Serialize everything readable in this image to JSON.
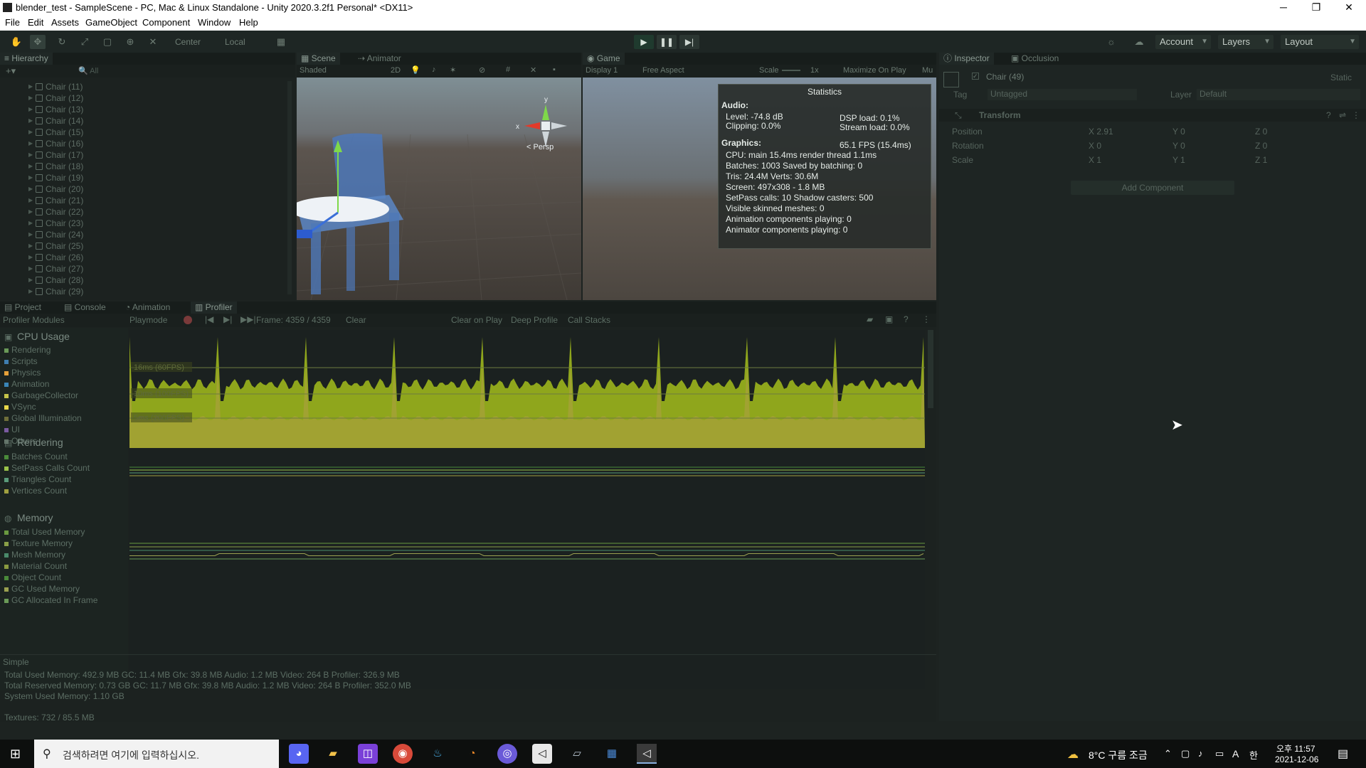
{
  "window": {
    "title": "blender_test - SampleScene - PC, Mac & Linux Standalone - Unity 2020.3.2f1 Personal* <DX11>",
    "minimize_icon": "─",
    "restore_icon": "❐",
    "close_icon": "✕"
  },
  "menu": [
    "File",
    "Edit",
    "Assets",
    "GameObject",
    "Component",
    "Window",
    "Help"
  ],
  "toolbar": {
    "center_label": "Center",
    "local_label": "Local",
    "account_label": "Account",
    "layers_label": "Layers",
    "layout_label": "Layout"
  },
  "hierarchy": {
    "tab": "Hierarchy",
    "search_placeholder": "All",
    "items": [
      "Chair (11)",
      "Chair (12)",
      "Chair (13)",
      "Chair (14)",
      "Chair (15)",
      "Chair (16)",
      "Chair (17)",
      "Chair (18)",
      "Chair (19)",
      "Chair (20)",
      "Chair (21)",
      "Chair (22)",
      "Chair (23)",
      "Chair (24)",
      "Chair (25)",
      "Chair (26)",
      "Chair (27)",
      "Chair (28)",
      "Chair (29)"
    ]
  },
  "scene": {
    "tabs": [
      "Scene",
      "Animator"
    ],
    "shading": "Shaded",
    "mode_2d": "2D",
    "persp_label": "< Persp",
    "gizmo_y": "y",
    "gizmo_x": "x"
  },
  "game": {
    "tab": "Game",
    "display": "Display 1",
    "aspect": "Free Aspect",
    "scale_label": "Scale",
    "scale_value": "1x",
    "maximize": "Maximize On Play",
    "mute": "Mu"
  },
  "statistics": {
    "title": "Statistics",
    "audio_head": "Audio:",
    "level": "Level: -74.8 dB",
    "dsp": "DSP load: 0.1%",
    "clipping": "Clipping: 0.0%",
    "stream": "Stream load: 0.0%",
    "graphics_head": "Graphics:",
    "fps": "65.1 FPS (15.4ms)",
    "cpu": "CPU: main 15.4ms  render thread 1.1ms",
    "batches": "Batches: 1003   Saved by batching: 0",
    "tris": "Tris: 24.4M       Verts: 30.6M",
    "screen": "Screen: 497x308 - 1.8 MB",
    "setpass": "SetPass calls: 10        Shadow casters: 500",
    "skinned": "Visible skinned meshes: 0",
    "anim": "Animation components playing: 0",
    "animator": "Animator components playing: 0"
  },
  "inspector": {
    "tabs": [
      "Inspector",
      "Occlusion"
    ],
    "object_name": "Chair (49)",
    "static_label": "Static",
    "tag_label": "Tag",
    "tag_value": "Untagged",
    "layer_label": "Layer",
    "layer_value": "Default",
    "transform_label": "Transform",
    "position_label": "Position",
    "rotation_label": "Rotation",
    "scale_label": "Scale",
    "position": {
      "x": "X 2.91",
      "y": "Y 0",
      "z": "Z 0"
    },
    "rotation": {
      "x": "X 0",
      "y": "Y 0",
      "z": "Z 0"
    },
    "scale": {
      "x": "X 1",
      "y": "Y 1",
      "z": "Z 1"
    },
    "add_component": "Add Component"
  },
  "bottom_tabs": [
    "Project",
    "Console",
    "Animation",
    "Profiler"
  ],
  "profiler": {
    "modules_label": "Profiler Modules",
    "playmode": "Playmode",
    "frame": "Frame: 4359 / 4359",
    "clear": "Clear",
    "clear_on_play": "Clear on Play",
    "deep_profile": "Deep Profile",
    "call_stacks": "Call Stacks",
    "cpu": {
      "title": "CPU Usage",
      "items": [
        "Rendering",
        "Scripts",
        "Physics",
        "Animation",
        "GarbageCollector",
        "VSync",
        "Global Illumination",
        "UI",
        "Others"
      ],
      "colors": [
        "#6a9a58",
        "#3f7eb0",
        "#e6a13a",
        "#3a86b8",
        "#c4c34a",
        "#e8d84a",
        "#6e6e3a",
        "#7a5aa0",
        "#6a7a70"
      ],
      "threshold_16": "16ms (60FPS)",
      "threshold_10": "10ms (100FPS)",
      "threshold_5": "5ms (200FPS)"
    },
    "rendering": {
      "title": "Rendering",
      "items": [
        "Batches Count",
        "SetPass Calls Count",
        "Triangles Count",
        "Vertices Count"
      ],
      "colors": [
        "#4a8a3a",
        "#9ac24a",
        "#5a9a7a",
        "#a0a040"
      ]
    },
    "memory": {
      "title": "Memory",
      "items": [
        "Total Used Memory",
        "Texture Memory",
        "Mesh Memory",
        "Material Count",
        "Object Count",
        "GC Used Memory",
        "GC Allocated In Frame"
      ],
      "colors": [
        "#6a9a40",
        "#8aa048",
        "#4a8a6a",
        "#8a9a40",
        "#4a8a3a",
        "#9aa050",
        "#6a9a58"
      ]
    },
    "detail_mode": "Simple",
    "summary": [
      "Total Used Memory: 492.9 MB    GC: 11.4 MB    Gfx: 39.8 MB    Audio: 1.2 MB    Video: 264 B    Profiler: 326.9 MB",
      "Total Reserved Memory: 0.73 GB    GC: 11.7 MB    Gfx: 39.8 MB    Audio: 1.2 MB    Video: 264 B    Profiler: 352.0 MB",
      "System Used Memory: 1.10 GB"
    ],
    "textures": "Textures: 732 / 85.5 MB"
  },
  "taskbar": {
    "search_placeholder": "검색하려면 여기에 입력하십시오.",
    "weather": "8°C  구름 조금",
    "ampm_time": "오후 11:57",
    "date": "2021-12-06",
    "ime_a": "A",
    "ime_han": "한"
  }
}
